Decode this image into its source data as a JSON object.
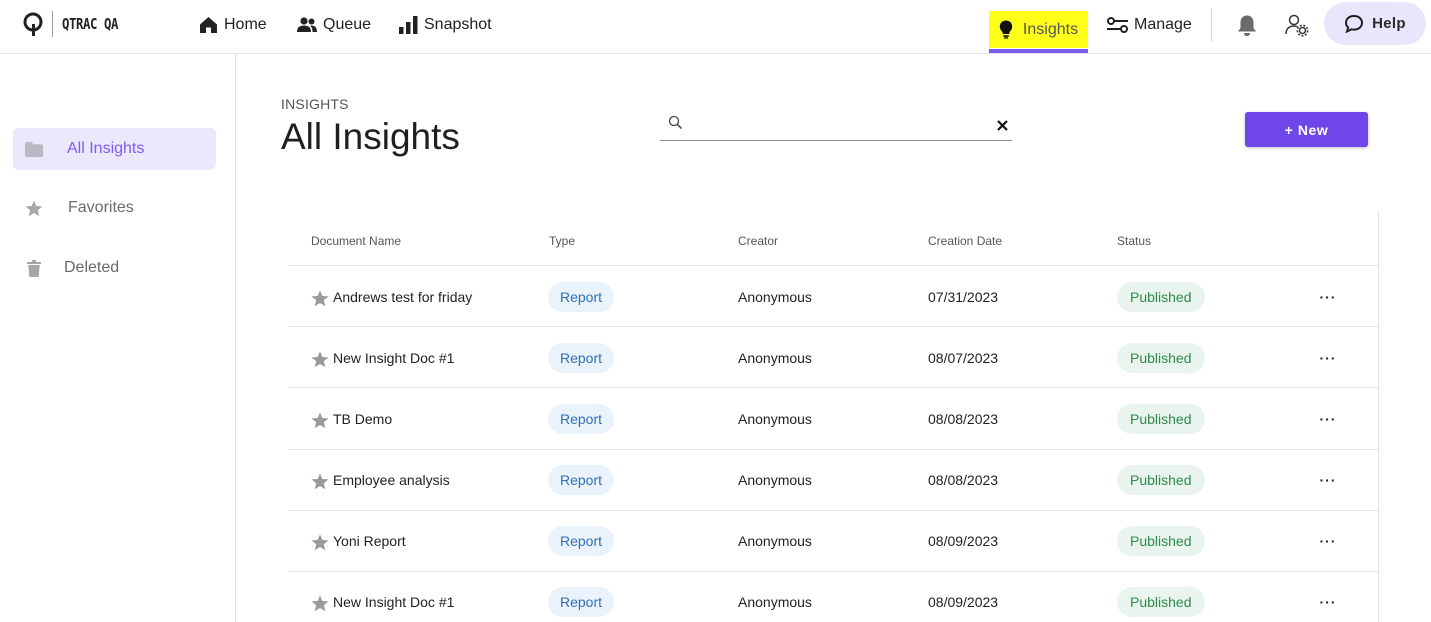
{
  "brand": {
    "name": "QTRAC QA"
  },
  "nav": {
    "home": "Home",
    "queue": "Queue",
    "snapshot": "Snapshot",
    "insights": "Insights",
    "manage": "Manage",
    "help": "Help"
  },
  "colors": {
    "accent": "#6f47e8",
    "highlight": "#ffff1a",
    "active_bg": "#ece8fc",
    "type_chip": "#eaf3fb",
    "status_chip": "#eaf4ee"
  },
  "sidebar": {
    "items": [
      {
        "label": "All Insights",
        "icon": "folder-icon",
        "active": true
      },
      {
        "label": "Favorites",
        "icon": "star-icon",
        "active": false
      },
      {
        "label": "Deleted",
        "icon": "trash-icon",
        "active": false
      }
    ]
  },
  "main": {
    "eyebrow": "INSIGHTS",
    "title": "All Insights",
    "search": {
      "value": "",
      "placeholder": ""
    },
    "new_button": "+ New"
  },
  "table": {
    "columns": [
      "Document Name",
      "Type",
      "Creator",
      "Creation Date",
      "Status"
    ],
    "rows": [
      {
        "name": "Andrews test for friday",
        "type": "Report",
        "creator": "Anonymous",
        "date": "07/31/2023",
        "status": "Published",
        "more": "···"
      },
      {
        "name": "New Insight Doc #1",
        "type": "Report",
        "creator": "Anonymous",
        "date": "08/07/2023",
        "status": "Published",
        "more": "···"
      },
      {
        "name": "TB Demo",
        "type": "Report",
        "creator": "Anonymous",
        "date": "08/08/2023",
        "status": "Published",
        "more": "···"
      },
      {
        "name": "Employee analysis",
        "type": "Report",
        "creator": "Anonymous",
        "date": "08/08/2023",
        "status": "Published",
        "more": "···"
      },
      {
        "name": "Yoni Report",
        "type": "Report",
        "creator": "Anonymous",
        "date": "08/09/2023",
        "status": "Published",
        "more": "···"
      },
      {
        "name": "New Insight Doc #1",
        "type": "Report",
        "creator": "Anonymous",
        "date": "08/09/2023",
        "status": "Published",
        "more": "···"
      }
    ]
  }
}
